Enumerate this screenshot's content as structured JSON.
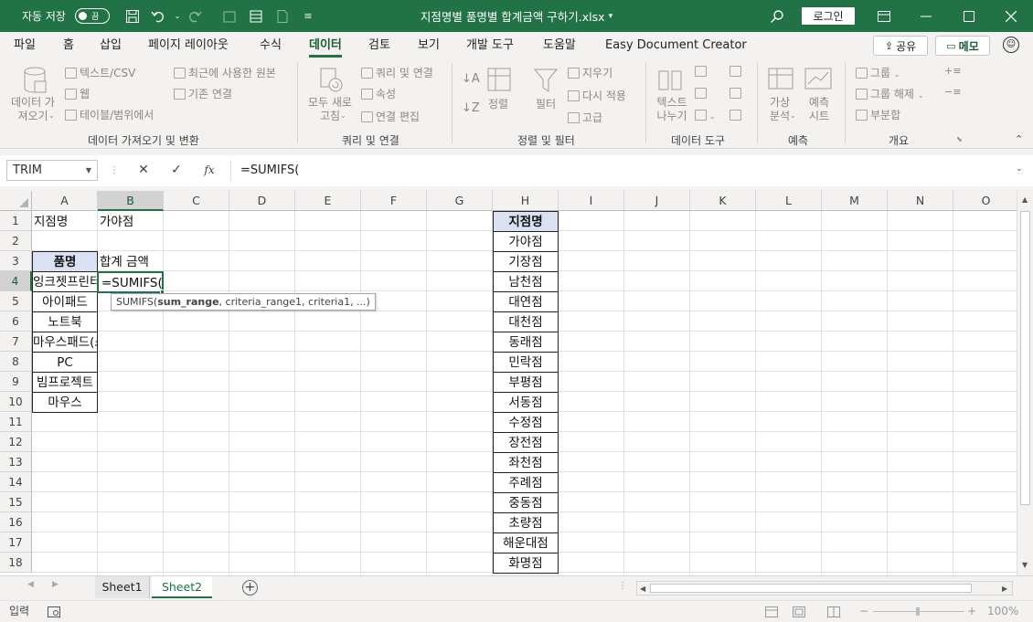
{
  "titlebar": {
    "autosave_label": "자동 저장",
    "autosave_toggle": "끔",
    "document_title": "지점명별 품명별 합계금액 구하기.xlsx",
    "title_caret": "▾",
    "login": "로그인",
    "save_icon": "save-icon",
    "undo_icon": "undo-icon"
  },
  "menu": {
    "tabs": [
      "파일",
      "홈",
      "삽입",
      "페이지 레이아웃",
      "수식",
      "데이터",
      "검토",
      "보기",
      "개발 도구",
      "도움말",
      "Easy Document Creator"
    ],
    "active_tab": "데이터",
    "share": "공유",
    "memo": "메모"
  },
  "ribbon": {
    "get_data": "데이터 가\n져오기",
    "from_text_csv": "텍스트/CSV",
    "from_web": "웹",
    "from_table": "테이블/범위에서",
    "recent_sources": "최근에 사용한 원본",
    "existing_connections": "기존 연결",
    "group_get_transform": "데이터 가져오기 및 변환",
    "refresh_all": "모두 새로\n고침",
    "queries_connections": "쿼리 및 연결",
    "properties": "속성",
    "edit_links": "연결 편집",
    "group_queries": "쿼리 및 연결",
    "sort": "정렬",
    "filter": "필터",
    "clear": "지우기",
    "reapply": "다시 적용",
    "advanced": "고급",
    "group_sort_filter": "정렬 및 필터",
    "text_to_columns": "텍스트\n나누기",
    "group_data_tools": "데이터 도구",
    "what_if": "가상\n분석",
    "forecast_sheet": "예측\n시트",
    "group_forecast": "예측",
    "group": "그룹",
    "ungroup": "그룹 해제",
    "subtotal": "부분합",
    "group_outline": "개요"
  },
  "formula_bar": {
    "name_box": "TRIM",
    "cancel": "✕",
    "enter": "✓",
    "fx": "fx",
    "formula": "=SUMIFS("
  },
  "columns": [
    "A",
    "B",
    "C",
    "D",
    "E",
    "F",
    "G",
    "H",
    "I",
    "J",
    "K",
    "L",
    "M",
    "N",
    "O"
  ],
  "rows": [
    "1",
    "2",
    "3",
    "4",
    "5",
    "6",
    "7",
    "8",
    "9",
    "10",
    "11",
    "12",
    "13",
    "14",
    "15",
    "16",
    "17",
    "18"
  ],
  "cells": {
    "a1": "지점명",
    "b1": "가야점",
    "a3": "품명",
    "b3": "합계 금액",
    "b4": "=SUMIFS(",
    "items": [
      "잉크젯프린터",
      "아이패드",
      "노트북",
      "마우스패드(스틸)",
      "PC",
      "빔프로젝트",
      "마우스"
    ]
  },
  "tooltip": {
    "fn": "SUMIFS(",
    "arg1": "sum_range",
    "rest": ", criteria_range1, criteria1, ...)"
  },
  "branch_list": {
    "header": "지점명",
    "items": [
      "가야점",
      "기장점",
      "남천점",
      "대연점",
      "대천점",
      "동래점",
      "민락점",
      "부평점",
      "서동점",
      "수정점",
      "장전점",
      "좌천점",
      "주례점",
      "중동점",
      "초량점",
      "해운대점",
      "화명점"
    ]
  },
  "sheets": [
    "Sheet1",
    "Sheet2"
  ],
  "active_sheet": "Sheet2",
  "status": {
    "mode": "입력",
    "zoom": "100%"
  }
}
